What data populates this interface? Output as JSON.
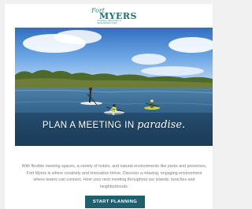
{
  "logo": {
    "line1": "Fort",
    "line2": "MYERS",
    "tagline": "ISLANDS, BEACHES & NEIGHBORHOODS"
  },
  "hero": {
    "headline_main": "PLAN A MEETING IN",
    "headline_script": "paradise."
  },
  "body": {
    "paragraph": "With flexible meeting spaces, a variety of hotels, and natural environments like parks and preserves, Fort Myers is where creativity and innovation thrive. Discover a relaxing, engaging environment where teams can connect. Host your next meeting throughout our islands, beaches and neighborhoods."
  },
  "cta": {
    "label": "START PLANNING"
  },
  "colors": {
    "brand_teal": "#1f6f76",
    "button": "#1f5f6e",
    "text_gray": "#7d7d7d"
  }
}
